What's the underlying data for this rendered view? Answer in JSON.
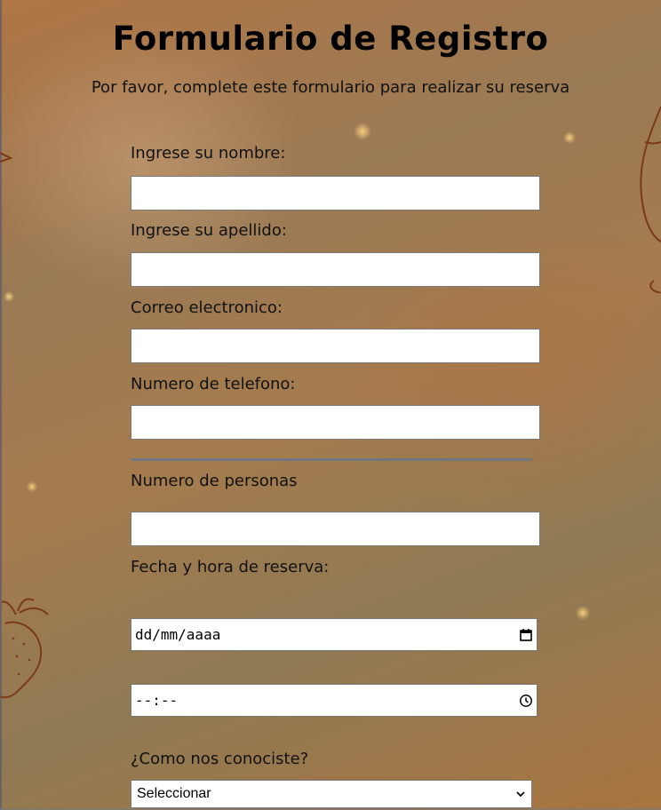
{
  "page": {
    "title": "Formulario de Registro",
    "subtitle": "Por favor, complete este formulario para realizar su reserva"
  },
  "form": {
    "nombre_label": "Ingrese su nombre:",
    "apellido_label": "Ingrese su apellido:",
    "correo_label": "Correo electronico:",
    "telefono_label": "Numero de telefono:",
    "personas_label": "Numero de personas",
    "fecha_hora_label": "Fecha y hora de reserva:",
    "date_placeholder": "dd/mm/aaaa",
    "time_placeholder": "--:--",
    "como_label": "¿Como nos conociste?",
    "como_selected": "Seleccionar"
  },
  "icons": {
    "calendar": "calendar-icon",
    "clock": "clock-icon",
    "chevron": "chevron-down-icon"
  }
}
